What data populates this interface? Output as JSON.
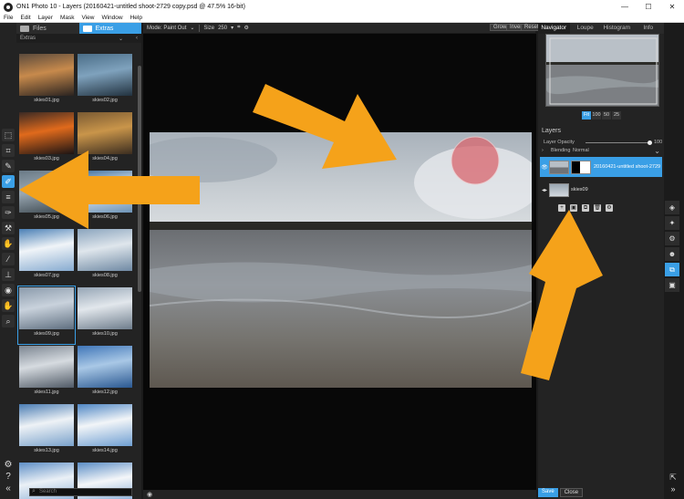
{
  "window": {
    "title": "ON1 Photo 10 - Layers (20160421-untitled shoot-2729 copy.psd @ 47.5% 16-bit)",
    "controls": [
      "—",
      "☐",
      "✕"
    ]
  },
  "menu": [
    "File",
    "Edit",
    "Layer",
    "Mask",
    "View",
    "Window",
    "Help"
  ],
  "browser": {
    "tab_files": "Files",
    "tab_extras": "Extras",
    "path": "Extras",
    "search_placeholder": "Search",
    "thumbnails": [
      {
        "name": "skies01.jpg",
        "colors": [
          "#5a4a3c",
          "#c78a4c",
          "#2a2320"
        ]
      },
      {
        "name": "skies02.jpg",
        "colors": [
          "#4a6d87",
          "#7fa2bd",
          "#22323f"
        ]
      },
      {
        "name": "skies03.jpg",
        "colors": [
          "#3a2a24",
          "#e06a1c",
          "#1c1414"
        ]
      },
      {
        "name": "skies04.jpg",
        "colors": [
          "#7a5a32",
          "#c9954a",
          "#3b2d20"
        ]
      },
      {
        "name": "skies05.jpg",
        "colors": [
          "#6a7a86",
          "#9aa8b3",
          "#3a454c"
        ]
      },
      {
        "name": "skies06.jpg",
        "colors": [
          "#3b6d9d",
          "#e8eef3",
          "#6c92b6"
        ]
      },
      {
        "name": "skies07.jpg",
        "colors": [
          "#4a7fb5",
          "#f0f4f8",
          "#87abd0"
        ]
      },
      {
        "name": "skies08.jpg",
        "colors": [
          "#8aa4bd",
          "#dfe6ec",
          "#6f89a3"
        ]
      },
      {
        "name": "skies09.jpg",
        "colors": [
          "#8a9aab",
          "#c9d2dc",
          "#5f6f80"
        ]
      },
      {
        "name": "skies10.jpg",
        "colors": [
          "#95a5b5",
          "#e2e7ec",
          "#6e7d8c"
        ]
      },
      {
        "name": "skies11.jpg",
        "colors": [
          "#7b8591",
          "#d6dbe0",
          "#505a66"
        ]
      },
      {
        "name": "skies12.jpg",
        "colors": [
          "#3f76b8",
          "#a9c8e6",
          "#2a5891"
        ]
      },
      {
        "name": "skies13.jpg",
        "colors": [
          "#4a7cb3",
          "#eef2f6",
          "#7aa2cb"
        ]
      },
      {
        "name": "skies14.jpg",
        "colors": [
          "#4e86c4",
          "#f2f5f8",
          "#6f9fd2"
        ]
      },
      {
        "name": "skies15.jpg",
        "colors": [
          "#5e8fc6",
          "#eaf0f6",
          "#87acd6"
        ]
      },
      {
        "name": "skies16.jpg",
        "colors": [
          "#5a8dc5",
          "#f4f6f9",
          "#7da5d3"
        ]
      }
    ]
  },
  "toolbar": {
    "mode": "Mode: Paint Out",
    "size_label": "Size",
    "size_value": "250",
    "grow": "Grow",
    "invert": "Invert",
    "reset": "Reset"
  },
  "navigator": {
    "tabs": [
      "Navigator",
      "Loupe",
      "Histogram",
      "Info"
    ],
    "zoom_options": [
      "Fit",
      "100",
      "50",
      "25"
    ]
  },
  "layers": {
    "title": "Layers",
    "opacity_label": "Layer Opacity",
    "opacity_value": "100",
    "blending_label": "Blending",
    "blending_value": "Normal",
    "items": [
      {
        "name": "20160421-untitled shoot-2729"
      },
      {
        "name": "skies09"
      }
    ]
  },
  "buttons": {
    "save": "Save",
    "close": "Close"
  },
  "colors": {
    "accent": "#3a9fe6",
    "arrow": "#f5a21a",
    "brush": "#d9666e"
  }
}
